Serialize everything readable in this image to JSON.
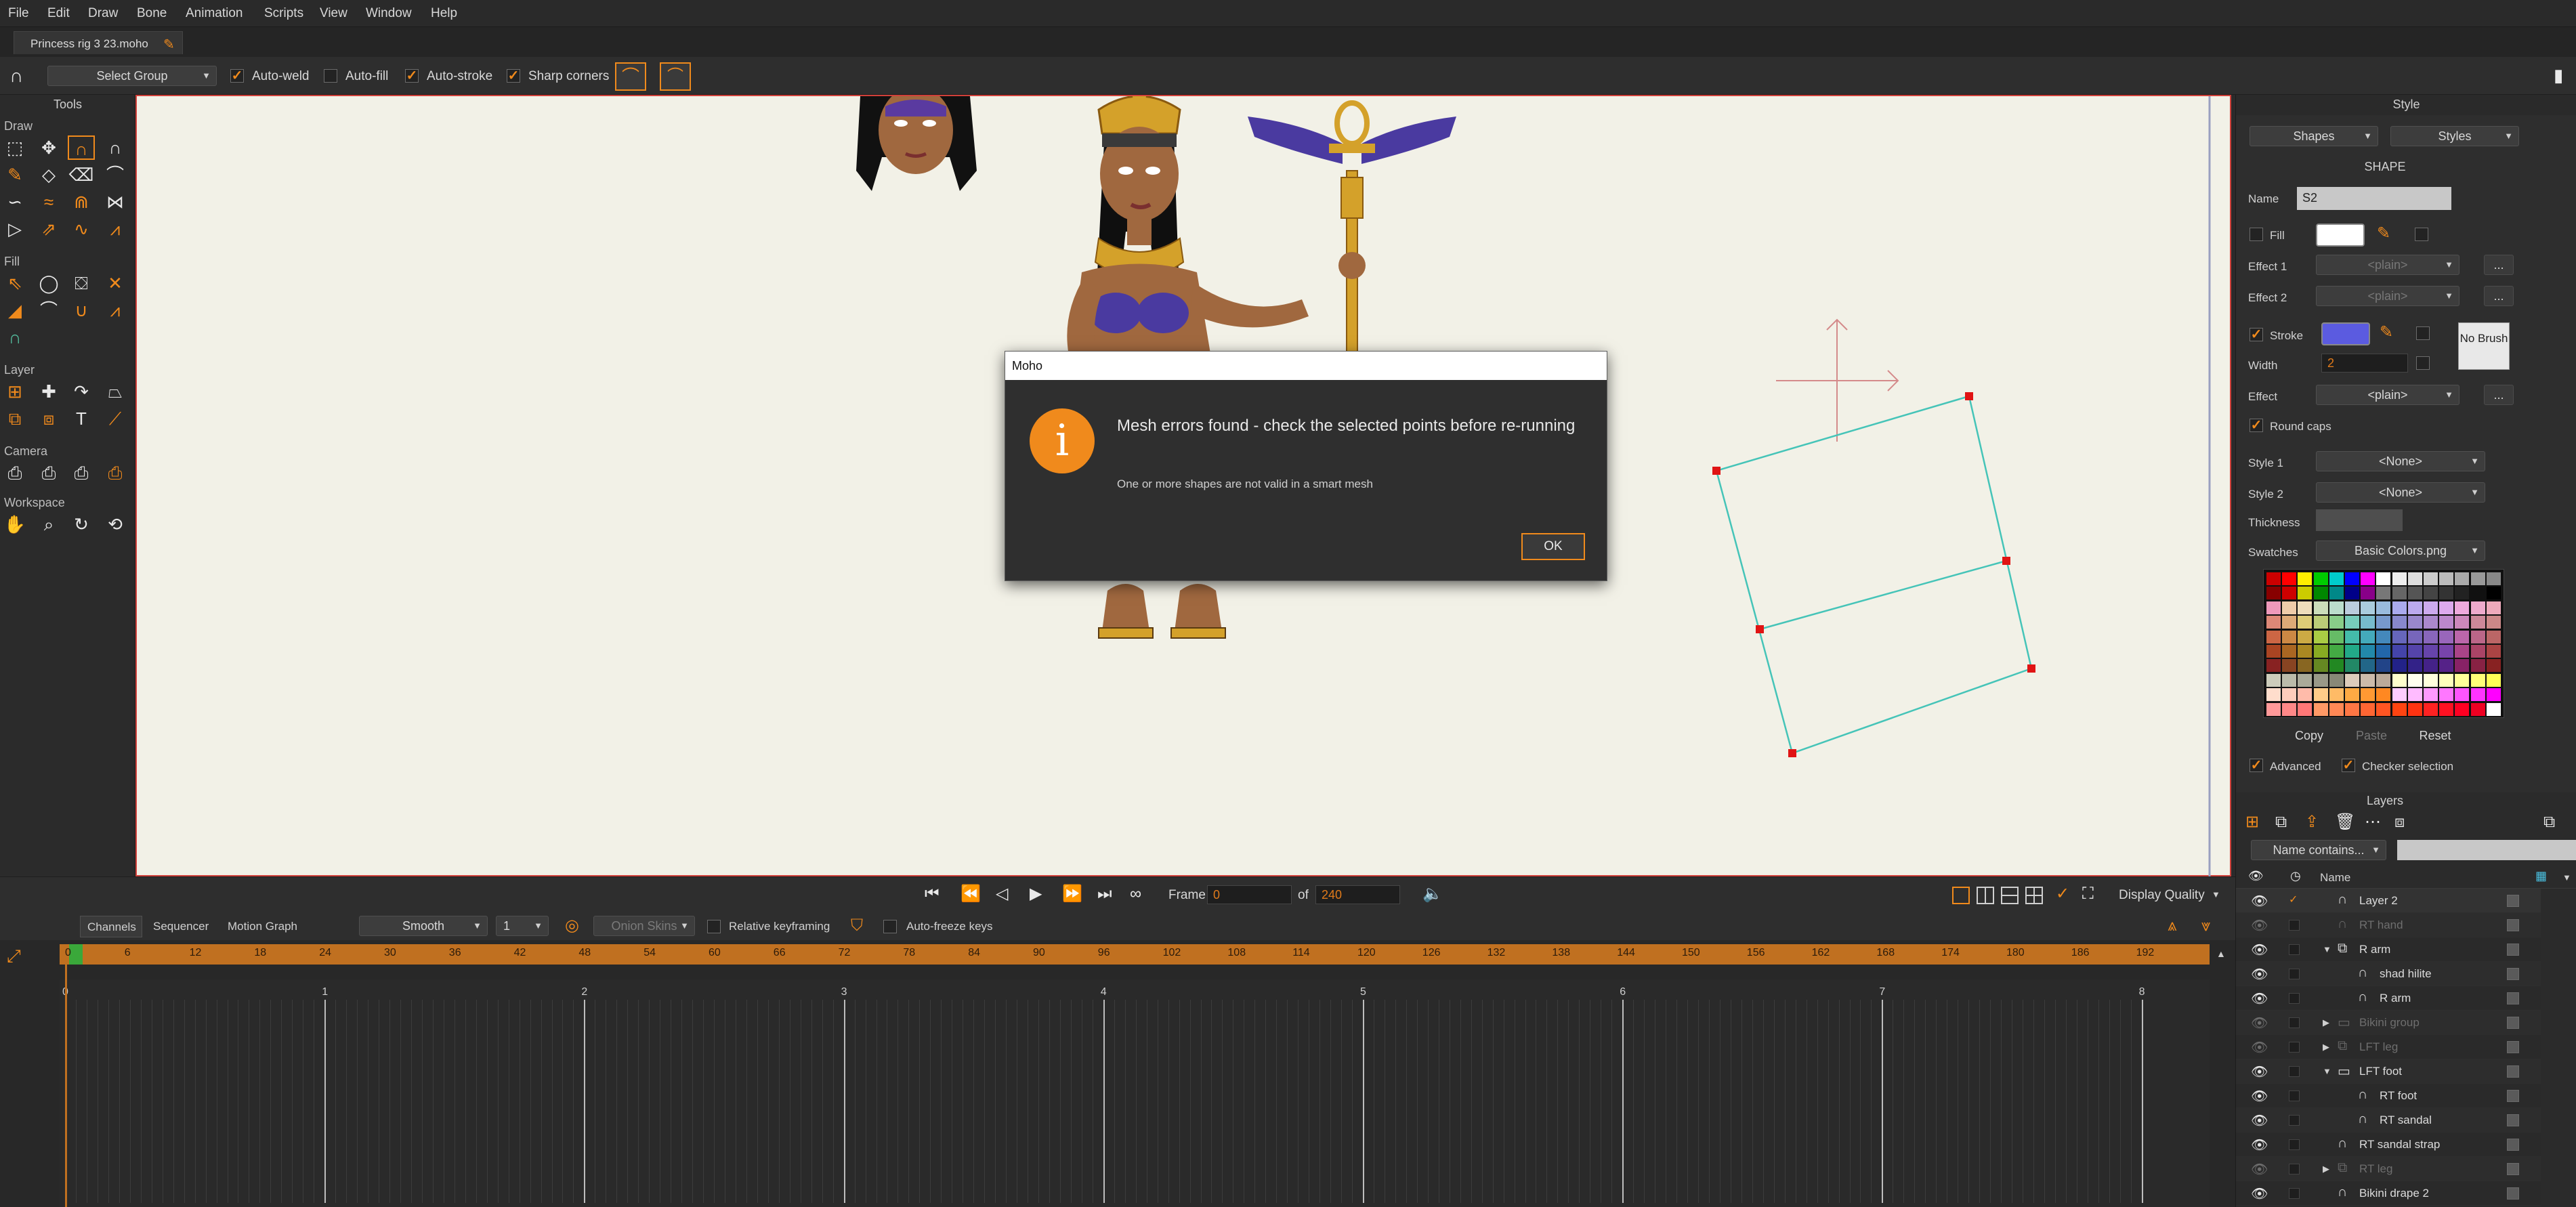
{
  "menu": [
    "File",
    "Edit",
    "Draw",
    "Bone",
    "Animation",
    "Scripts",
    "View",
    "Window",
    "Help"
  ],
  "document_tab": {
    "title": "Princess rig 3 23.moho"
  },
  "tool_options": {
    "select_group": "Select Group",
    "checks": [
      {
        "label": "Auto-weld",
        "checked": true
      },
      {
        "label": "Auto-fill",
        "checked": false
      },
      {
        "label": "Auto-stroke",
        "checked": true
      },
      {
        "label": "Sharp corners",
        "checked": true
      }
    ]
  },
  "tools_panel": {
    "title": "Tools",
    "sections": {
      "draw": "Draw",
      "fill": "Fill",
      "layer": "Layer",
      "camera": "Camera",
      "workspace": "Workspace"
    }
  },
  "dialog": {
    "title": "Moho",
    "heading": "Mesh errors found - check the selected points before re-running",
    "message": "One or more shapes are not valid in a smart mesh",
    "ok": "OK",
    "icon": "info-icon"
  },
  "playback": {
    "frame_label": "Frame",
    "frame_value": "0",
    "of_label": "of",
    "total": "240",
    "display_quality": "Display Quality"
  },
  "timeline": {
    "tabs": [
      "Channels",
      "Sequencer",
      "Motion Graph"
    ],
    "interpolation": "Smooth",
    "step": "1",
    "onion_skins": "Onion Skins",
    "relative_keyframing": "Relative keyframing",
    "auto_freeze": "Auto-freeze keys",
    "ruler_frames": [
      "0",
      "6",
      "12",
      "18",
      "24",
      "30",
      "36",
      "42",
      "48",
      "54",
      "60",
      "66",
      "72",
      "78",
      "84",
      "90",
      "96",
      "102",
      "108",
      "114",
      "120",
      "126",
      "132",
      "138",
      "144",
      "150",
      "156",
      "162",
      "168",
      "174",
      "180",
      "186",
      "192"
    ],
    "seconds": [
      "0",
      "1",
      "2",
      "3",
      "4",
      "5",
      "6",
      "7",
      "8"
    ]
  },
  "style_panel": {
    "title": "Style",
    "shapes_btn": "Shapes",
    "styles_btn": "Styles",
    "section": "SHAPE",
    "name_label": "Name",
    "name_value": "S2",
    "fill_label": "Fill",
    "fill_color": "#ffffff",
    "effect1_label": "Effect 1",
    "effect2_label": "Effect 2",
    "plain": "<plain>",
    "stroke_label": "Stroke",
    "stroke_color": "#5b5be0",
    "width_label": "Width",
    "width_value": "2",
    "no_brush": "No Brush",
    "effect_label": "Effect",
    "round_caps": "Round caps",
    "style1_label": "Style 1",
    "style2_label": "Style 2",
    "none": "<None>",
    "thickness_label": "Thickness",
    "swatches_label": "Swatches",
    "swatches_value": "Basic Colors.png",
    "copy": "Copy",
    "paste": "Paste",
    "reset": "Reset",
    "advanced": "Advanced",
    "checker_selection": "Checker selection"
  },
  "layers_panel": {
    "title": "Layers",
    "filter": "Name contains...",
    "name_col": "Name",
    "rows": [
      {
        "name": "Layer 2",
        "dim": false
      },
      {
        "name": "RT hand",
        "dim": true
      },
      {
        "name": "R arm",
        "dim": false
      },
      {
        "name": "shad hilite",
        "dim": false
      },
      {
        "name": "R arm",
        "dim": false
      },
      {
        "name": "Bikini group",
        "dim": true
      },
      {
        "name": "LFT leg",
        "dim": true
      },
      {
        "name": "LFT foot",
        "dim": false
      },
      {
        "name": "RT foot",
        "dim": false
      },
      {
        "name": "RT sandal",
        "dim": false
      },
      {
        "name": "RT sandal strap",
        "dim": false
      },
      {
        "name": "RT leg",
        "dim": true
      },
      {
        "name": "Bikini drape 2",
        "dim": false
      }
    ]
  }
}
